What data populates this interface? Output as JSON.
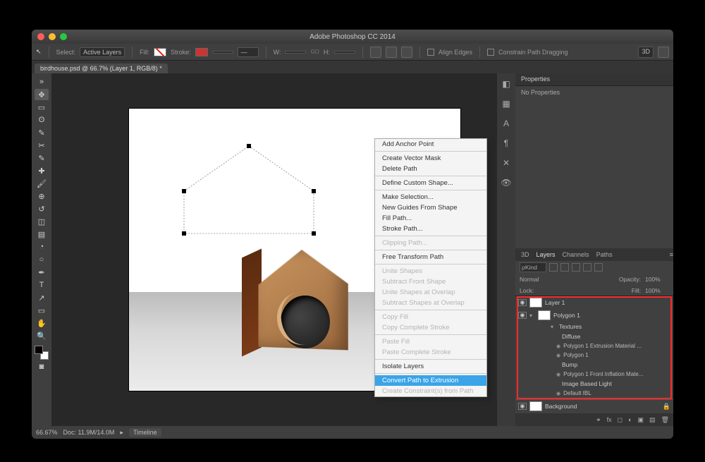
{
  "title": "Adobe Photoshop CC 2014",
  "document_tab": "birdhouse.psd @ 66.7% (Layer 1, RGB/8) *",
  "optbar": {
    "select_label": "Select:",
    "select_value": "Active Layers",
    "fill_label": "Fill:",
    "stroke_label": "Stroke:",
    "w_label": "W:",
    "h_label": "H:",
    "go_label": "GO",
    "align_edges": "Align Edges",
    "constrain": "Constrain Path Dragging",
    "threeD": "3D"
  },
  "context_menu": {
    "items": [
      {
        "label": "Add Anchor Point",
        "enabled": true
      },
      {
        "sep": true
      },
      {
        "label": "Create Vector Mask",
        "enabled": true
      },
      {
        "label": "Delete Path",
        "enabled": true
      },
      {
        "sep": true
      },
      {
        "label": "Define Custom Shape...",
        "enabled": true
      },
      {
        "sep": true
      },
      {
        "label": "Make Selection...",
        "enabled": true
      },
      {
        "label": "New Guides From Shape",
        "enabled": true
      },
      {
        "label": "Fill Path...",
        "enabled": true
      },
      {
        "label": "Stroke Path...",
        "enabled": true
      },
      {
        "sep": true
      },
      {
        "label": "Clipping Path...",
        "enabled": false
      },
      {
        "sep": true
      },
      {
        "label": "Free Transform Path",
        "enabled": true
      },
      {
        "sep": true
      },
      {
        "label": "Unite Shapes",
        "enabled": false
      },
      {
        "label": "Subtract Front Shape",
        "enabled": false
      },
      {
        "label": "Unite Shapes at Overlap",
        "enabled": false
      },
      {
        "label": "Subtract Shapes at Overlap",
        "enabled": false
      },
      {
        "sep": true
      },
      {
        "label": "Copy Fill",
        "enabled": false
      },
      {
        "label": "Copy Complete Stroke",
        "enabled": false
      },
      {
        "sep": true
      },
      {
        "label": "Paste Fill",
        "enabled": false
      },
      {
        "label": "Paste Complete Stroke",
        "enabled": false
      },
      {
        "sep": true
      },
      {
        "label": "Isolate Layers",
        "enabled": true
      },
      {
        "sep": true
      },
      {
        "label": "Convert Path to Extrusion",
        "enabled": true,
        "selected": true
      },
      {
        "label": "Create Constraint(s) from Path",
        "enabled": false
      }
    ]
  },
  "properties": {
    "tab_label": "Properties",
    "body_text": "No Properties"
  },
  "extra_tabs": {
    "threeD": "3D",
    "layers": "Layers",
    "channels": "Channels",
    "paths": "Paths"
  },
  "layers_panel": {
    "kind_label": "ρKind",
    "blend": "Normal",
    "opacity_label": "Opacity:",
    "opacity_value": "100%",
    "lock_label": "Lock:",
    "fill_label": "Fill:",
    "fill_value": "100%",
    "layers": [
      {
        "name": "Layer 1",
        "eye": true,
        "thumb": true,
        "indent": 0
      },
      {
        "name": "Polygon 1",
        "eye": true,
        "thumb": true,
        "indent": 0,
        "twirl": "▾"
      },
      {
        "name": "Textures",
        "indent": 1,
        "twirl": "▾"
      },
      {
        "name": "Diffuse",
        "indent": 2
      },
      {
        "name": "Polygon 1 Extrusion Material ...",
        "indent": 3,
        "eyemini": true
      },
      {
        "name": "Polygon 1",
        "indent": 3,
        "eyemini": true
      },
      {
        "name": "Bump",
        "indent": 2
      },
      {
        "name": "Polygon 1 Front Inflation Mate...",
        "indent": 3,
        "eyemini": true
      },
      {
        "name": "Image Based Light",
        "indent": 2
      },
      {
        "name": "Default IBL",
        "indent": 3,
        "eyemini": true
      },
      {
        "name": "Background",
        "eye": true,
        "thumb": true,
        "indent": 0,
        "locked": true
      }
    ]
  },
  "status": {
    "zoom": "66.67%",
    "doc": "Doc: 11.9M/14.0M",
    "timeline": "Timeline"
  }
}
